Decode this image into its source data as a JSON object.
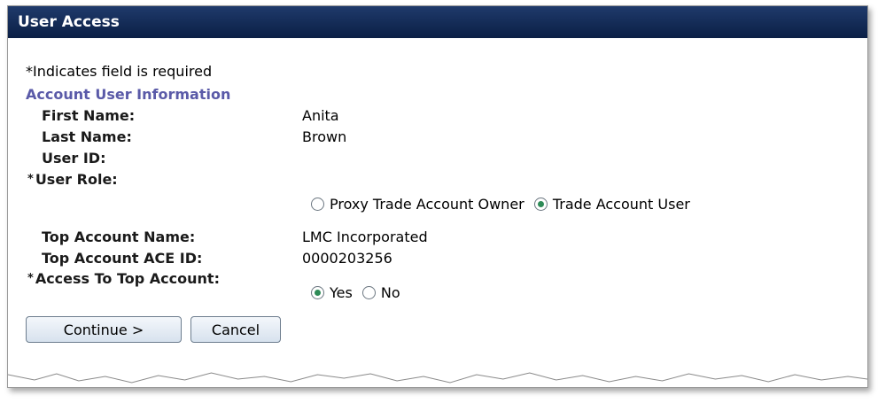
{
  "window": {
    "title": "User Access"
  },
  "form": {
    "required_note": "*Indicates field is required",
    "section_title": "Account User Information",
    "required_mark": "*",
    "fields": {
      "first_name": {
        "label": "First Name:",
        "value": "Anita"
      },
      "last_name": {
        "label": "Last Name:",
        "value": "Brown"
      },
      "user_id": {
        "label": "User ID:",
        "value": ""
      },
      "user_role": {
        "label": "User Role:",
        "options": [
          "Proxy Trade Account Owner",
          "Trade Account User"
        ],
        "selected": "Trade Account User"
      },
      "top_account_name": {
        "label": "Top Account Name:",
        "value": "LMC Incorporated"
      },
      "top_account_ace_id": {
        "label": "Top Account ACE ID:",
        "value": "0000203256"
      },
      "access_top_account": {
        "label": "Access To Top Account:",
        "options": [
          "Yes",
          "No"
        ],
        "selected": "Yes"
      }
    },
    "buttons": {
      "continue": "Continue >",
      "cancel": "Cancel"
    }
  },
  "colors": {
    "title_bar": "#0b1f45",
    "section_title": "#5a5aa8",
    "radio_selected": "#2e8b57"
  }
}
